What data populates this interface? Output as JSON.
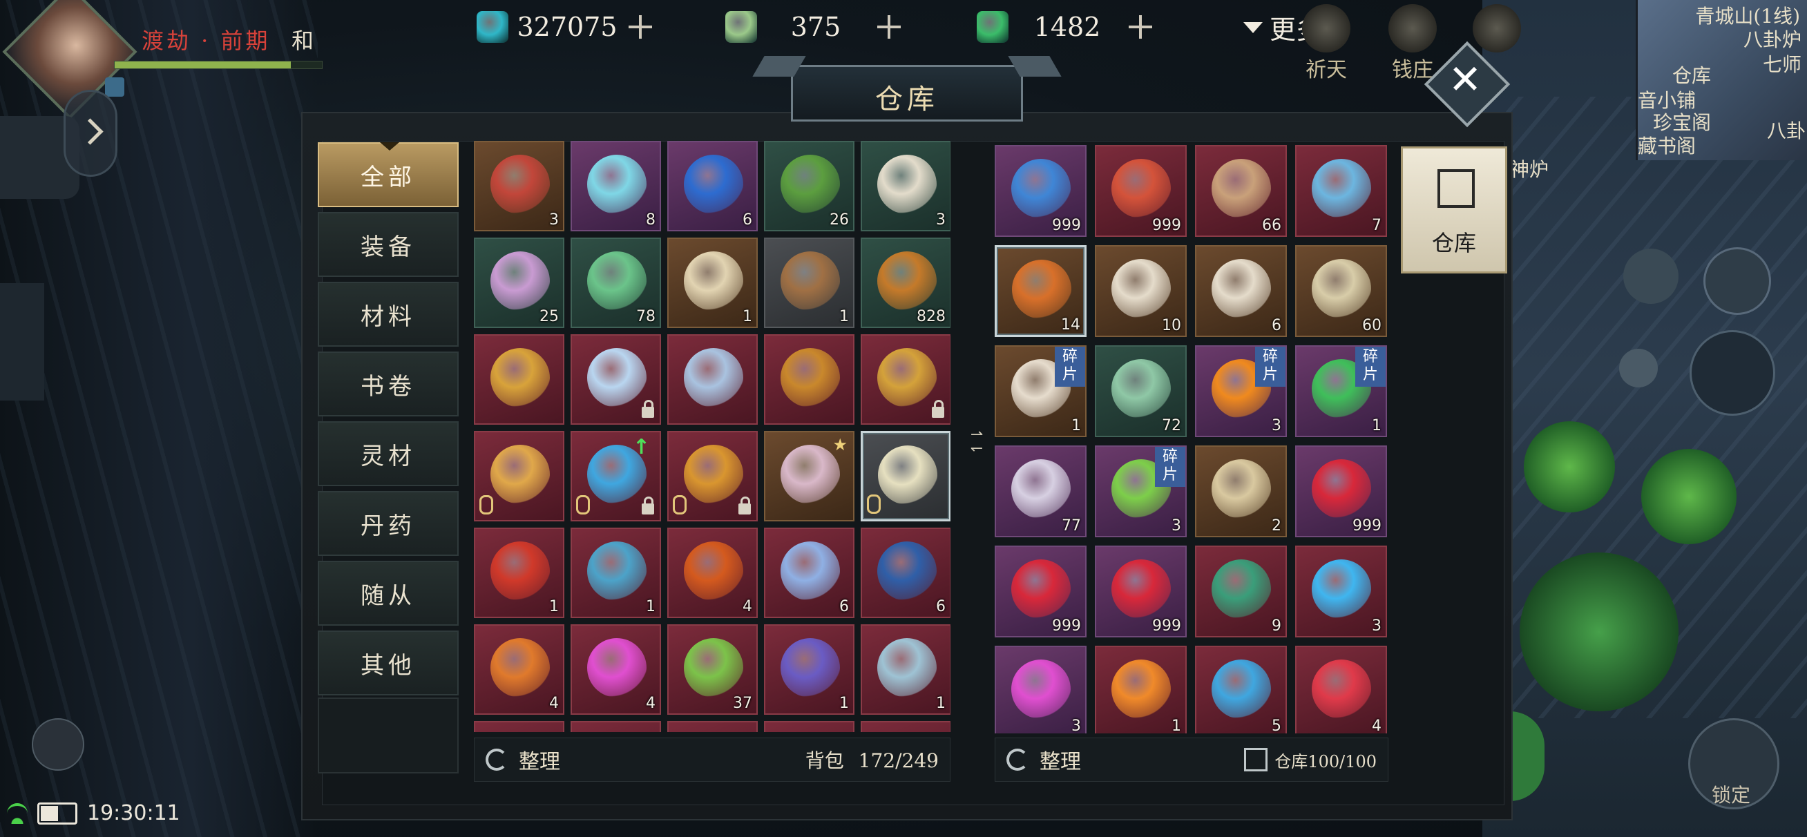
{
  "player": {
    "name": "渡劫 · 前期",
    "mode": "和",
    "hp_fraction": 0.85
  },
  "resources": [
    {
      "icon": "blue-crystal-icon",
      "value": "327075",
      "color": "#2fb7c8"
    },
    {
      "icon": "jade-tablet-icon",
      "value": "375",
      "color": "#9bc98a"
    },
    {
      "icon": "green-jade-coin-icon",
      "value": "1482",
      "color": "#3bbd6a"
    }
  ],
  "more_label": "更多",
  "top_buttons": [
    {
      "label": "祈天",
      "icon": "pray-icon"
    },
    {
      "label": "钱庄",
      "icon": "bank-icon"
    }
  ],
  "minimap": {
    "title": "青城山(1线)",
    "labels": [
      "八卦炉",
      "七师",
      "仓库",
      "音小铺",
      "珍宝阁",
      "藏书阁",
      "神炉",
      "八卦"
    ]
  },
  "status": {
    "time": "19:30:11",
    "battery_fraction": 0.55
  },
  "panel": {
    "title": "仓库"
  },
  "tabs": [
    "全部",
    "装备",
    "材料",
    "书卷",
    "灵材",
    "丹药",
    "随从",
    "其他"
  ],
  "active_tab": 0,
  "bag": {
    "items": [
      {
        "name": "red-claw-icon",
        "quality": "q-brown",
        "count": "3",
        "color": "#c2463a"
      },
      {
        "name": "purple-wisp-icon",
        "quality": "q-purple",
        "count": "8",
        "color": "#7fd7e6"
      },
      {
        "name": "blue-orb-icon",
        "quality": "q-purple",
        "count": "6",
        "color": "#2d6cd0"
      },
      {
        "name": "jade-toad-icon",
        "quality": "q-green",
        "count": "26",
        "color": "#5c9e3f"
      },
      {
        "name": "paper-sheets-icon",
        "quality": "q-green",
        "count": "3",
        "color": "#e3dccb"
      },
      {
        "name": "pink-pearl-icon",
        "quality": "q-green",
        "count": "25",
        "color": "#c99bd2"
      },
      {
        "name": "jade-buddha-icon",
        "quality": "q-green",
        "count": "78",
        "color": "#6bc48a"
      },
      {
        "name": "folding-fan-icon",
        "quality": "q-brown",
        "count": "1",
        "color": "#e2d4b2"
      },
      {
        "name": "bamboo-bow-icon",
        "quality": "q-gray",
        "count": "1",
        "color": "#a07044"
      },
      {
        "name": "roast-chicken-icon",
        "quality": "q-green",
        "count": "828",
        "color": "#c57a2a"
      },
      {
        "name": "gold-horn-crown-icon",
        "quality": "q-red",
        "count": "",
        "color": "#d8a33a"
      },
      {
        "name": "ice-scroll-icon",
        "quality": "q-red",
        "count": "",
        "color": "#b9d6f0",
        "lock": true
      },
      {
        "name": "spirit-staff-icon",
        "quality": "q-red",
        "count": "",
        "color": "#a9c3e0"
      },
      {
        "name": "gold-hairpin-icon",
        "quality": "q-red",
        "count": "",
        "color": "#c9882c"
      },
      {
        "name": "gold-pendant-icon",
        "quality": "q-red",
        "count": "",
        "color": "#d4a23a",
        "lock": true
      },
      {
        "name": "gold-ring-icon",
        "quality": "q-red",
        "count": "",
        "color": "#e0a84a",
        "chain": true
      },
      {
        "name": "blue-feather-talisman-icon",
        "quality": "q-red",
        "count": "",
        "color": "#3fa7e0",
        "chain": true,
        "lock": true,
        "upgrade": true
      },
      {
        "name": "gold-bracelet-icon",
        "quality": "q-red",
        "count": "",
        "color": "#d9962f",
        "chain": true,
        "lock": true
      },
      {
        "name": "flower-scroll-icon",
        "quality": "q-brown",
        "count": "",
        "color": "#d9b8c9",
        "star": true
      },
      {
        "name": "yinyang-gourd-icon",
        "quality": "q-gray",
        "count": "",
        "color": "#e6e0c0",
        "chain": true,
        "selected": true
      },
      {
        "name": "red-bead-bracelet-icon",
        "quality": "q-red",
        "count": "1",
        "color": "#d0392a"
      },
      {
        "name": "blue-vase-icon",
        "quality": "q-red",
        "count": "1",
        "color": "#4ca3c9"
      },
      {
        "name": "fire-gourd-icon",
        "quality": "q-red",
        "count": "4",
        "color": "#d45a1e"
      },
      {
        "name": "crystal-shard-icon",
        "quality": "q-red",
        "count": "6",
        "color": "#8fb0e4"
      },
      {
        "name": "thunder-orb-icon",
        "quality": "q-red",
        "count": "6",
        "color": "#2f5fa8"
      },
      {
        "name": "flame-orb-icon",
        "quality": "q-red",
        "count": "4",
        "color": "#e07a2c"
      },
      {
        "name": "pink-diamond-icon",
        "quality": "q-red",
        "count": "4",
        "color": "#e04fd0"
      },
      {
        "name": "bamboo-tube-icon",
        "quality": "q-red",
        "count": "37",
        "color": "#7cc34a"
      },
      {
        "name": "purple-ore-icon",
        "quality": "q-red",
        "count": "1",
        "color": "#6a5cc4"
      },
      {
        "name": "spirit-waterfall-icon",
        "quality": "q-red",
        "count": "1",
        "color": "#9ec3d4"
      },
      {
        "name": "partial-item-icon",
        "quality": "q-red",
        "count": "",
        "color": "#7a3a3a"
      },
      {
        "name": "partial-item-icon",
        "quality": "q-red",
        "count": "",
        "color": "#7a3a3a"
      },
      {
        "name": "partial-item-icon",
        "quality": "q-red",
        "count": "",
        "color": "#7a3a3a"
      },
      {
        "name": "partial-item-icon",
        "quality": "q-red",
        "count": "",
        "color": "#7a3a3a"
      },
      {
        "name": "partial-item-icon",
        "quality": "q-red",
        "count": "",
        "color": "#7a3a3a"
      }
    ],
    "sort_label": "整理",
    "capacity_label": "背包",
    "capacity": "172/249"
  },
  "warehouse": {
    "items": [
      {
        "name": "blue-crystal-cluster-icon",
        "quality": "q-purple",
        "count": "999",
        "color": "#3f86d6"
      },
      {
        "name": "red-crystal-cluster-icon",
        "quality": "q-red",
        "count": "999",
        "color": "#d4533a"
      },
      {
        "name": "red-scroll-icon",
        "quality": "q-red",
        "count": "66",
        "color": "#c9a17a"
      },
      {
        "name": "spirit-mirror-icon",
        "quality": "q-red",
        "count": "7",
        "color": "#6cb6e0"
      },
      {
        "name": "fire-seal-icon",
        "quality": "q-brown",
        "count": "14",
        "color": "#d8702a",
        "selected": true
      },
      {
        "name": "tied-scroll-icon",
        "quality": "q-brown",
        "count": "10",
        "color": "#e5dccb"
      },
      {
        "name": "tied-scroll-icon",
        "quality": "q-brown",
        "count": "6",
        "color": "#e5dccb"
      },
      {
        "name": "gold-scroll-icon",
        "quality": "q-brown",
        "count": "60",
        "color": "#d8cda9"
      },
      {
        "name": "talisman-fragment-icon",
        "quality": "q-brown",
        "count": "1",
        "color": "#e6dccd",
        "frag": true
      },
      {
        "name": "green-scroll-icon",
        "quality": "q-green",
        "count": "72",
        "color": "#8fc8a6"
      },
      {
        "name": "orange-cloth-fragment-icon",
        "quality": "q-purple",
        "count": "3",
        "color": "#f08a1e",
        "frag": true
      },
      {
        "name": "jade-blade-fragment-icon",
        "quality": "q-purple",
        "count": "1",
        "color": "#3fbf5a",
        "frag": true
      },
      {
        "name": "purple-scroll-icon",
        "quality": "q-purple",
        "count": "77",
        "color": "#d7d0e2"
      },
      {
        "name": "lotus-leaf-fragment-icon",
        "quality": "q-purple",
        "count": "3",
        "color": "#7dcf4a",
        "frag": true
      },
      {
        "name": "map-scroll-icon",
        "quality": "q-brown",
        "count": "2",
        "color": "#d9c9a0"
      },
      {
        "name": "red-pill-icon",
        "quality": "q-purple",
        "count": "999",
        "color": "#d8283a"
      },
      {
        "name": "red-pill-icon",
        "quality": "q-purple",
        "count": "999",
        "color": "#d8283a"
      },
      {
        "name": "red-pill-icon",
        "quality": "q-purple",
        "count": "999",
        "color": "#d8283a"
      },
      {
        "name": "herb-branch-icon",
        "quality": "q-red",
        "count": "9",
        "color": "#3a9e7a"
      },
      {
        "name": "blue-spirit-flame-icon",
        "quality": "q-red",
        "count": "3",
        "color": "#3fb6f0"
      },
      {
        "name": "pink-potion-icon",
        "quality": "q-purple",
        "count": "3",
        "color": "#e04fd0"
      },
      {
        "name": "orange-potion-icon",
        "quality": "q-red",
        "count": "1",
        "color": "#f08a2a"
      },
      {
        "name": "blue-potion-icon",
        "quality": "q-red",
        "count": "5",
        "color": "#3fa7e0"
      },
      {
        "name": "red-potion-icon",
        "quality": "q-red",
        "count": "4",
        "color": "#e03a4a"
      }
    ],
    "sort_label": "整理",
    "capacity_text": "仓库100/100"
  },
  "side_tab_label": "仓库",
  "lock_label": "锁定"
}
